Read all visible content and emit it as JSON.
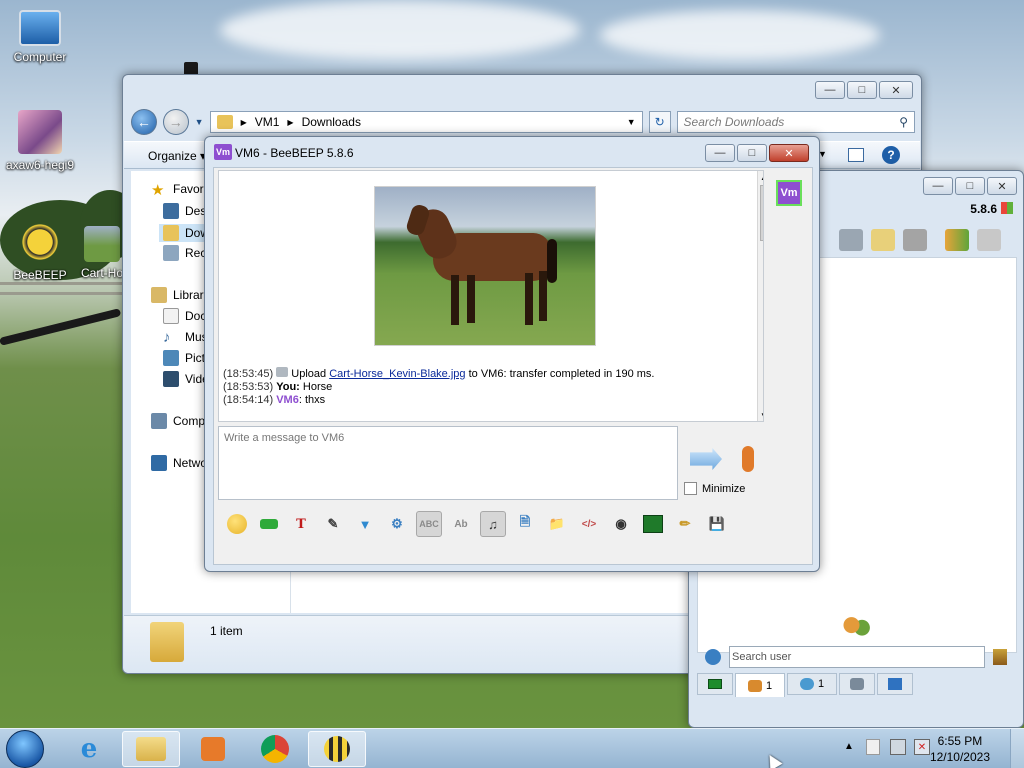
{
  "desktop": {
    "icons": [
      {
        "label": "Computer"
      },
      {
        "label": "axaw6-hegi9"
      },
      {
        "label": "BeeBEEP"
      },
      {
        "label": "Cart-Ho"
      }
    ]
  },
  "explorer": {
    "breadcrumb": [
      "VM1",
      "Downloads"
    ],
    "search_placeholder": "Search Downloads",
    "organize_label": "Organize",
    "nav_items": [
      "Favori",
      "Desk",
      "Dow",
      "Rece",
      "Librari",
      "Docu",
      "Mus",
      "Pictu",
      "Vide",
      "Comp",
      "Netwo"
    ],
    "item_count": "1 item"
  },
  "chat": {
    "title": "VM6 - BeeBEEP 5.8.6",
    "badge": "Vm",
    "log": [
      {
        "time": "(18:53:45)",
        "pre": "Upload ",
        "link": "Cart-Horse_Kevin-Blake.jpg",
        "post": " to VM6: transfer completed in 190 ms."
      },
      {
        "time": "(18:53:53)",
        "who": "You:",
        "text": " Horse"
      },
      {
        "time": "(18:54:14)",
        "who": "VM6",
        "text": ": thxs"
      }
    ],
    "input_placeholder": "Write a message to VM6",
    "minimize_label": "Minimize"
  },
  "roster": {
    "version": "5.8.6",
    "search_placeholder": "Search user",
    "tab_users_count": "1",
    "tab_chats_count": "1"
  },
  "taskbar": {
    "time": "6:55 PM",
    "date": "12/10/2023"
  },
  "colors": {
    "accent_purple": "#8e4fd0",
    "link_blue": "#0a2a9a",
    "close_red": "#c0402c"
  }
}
